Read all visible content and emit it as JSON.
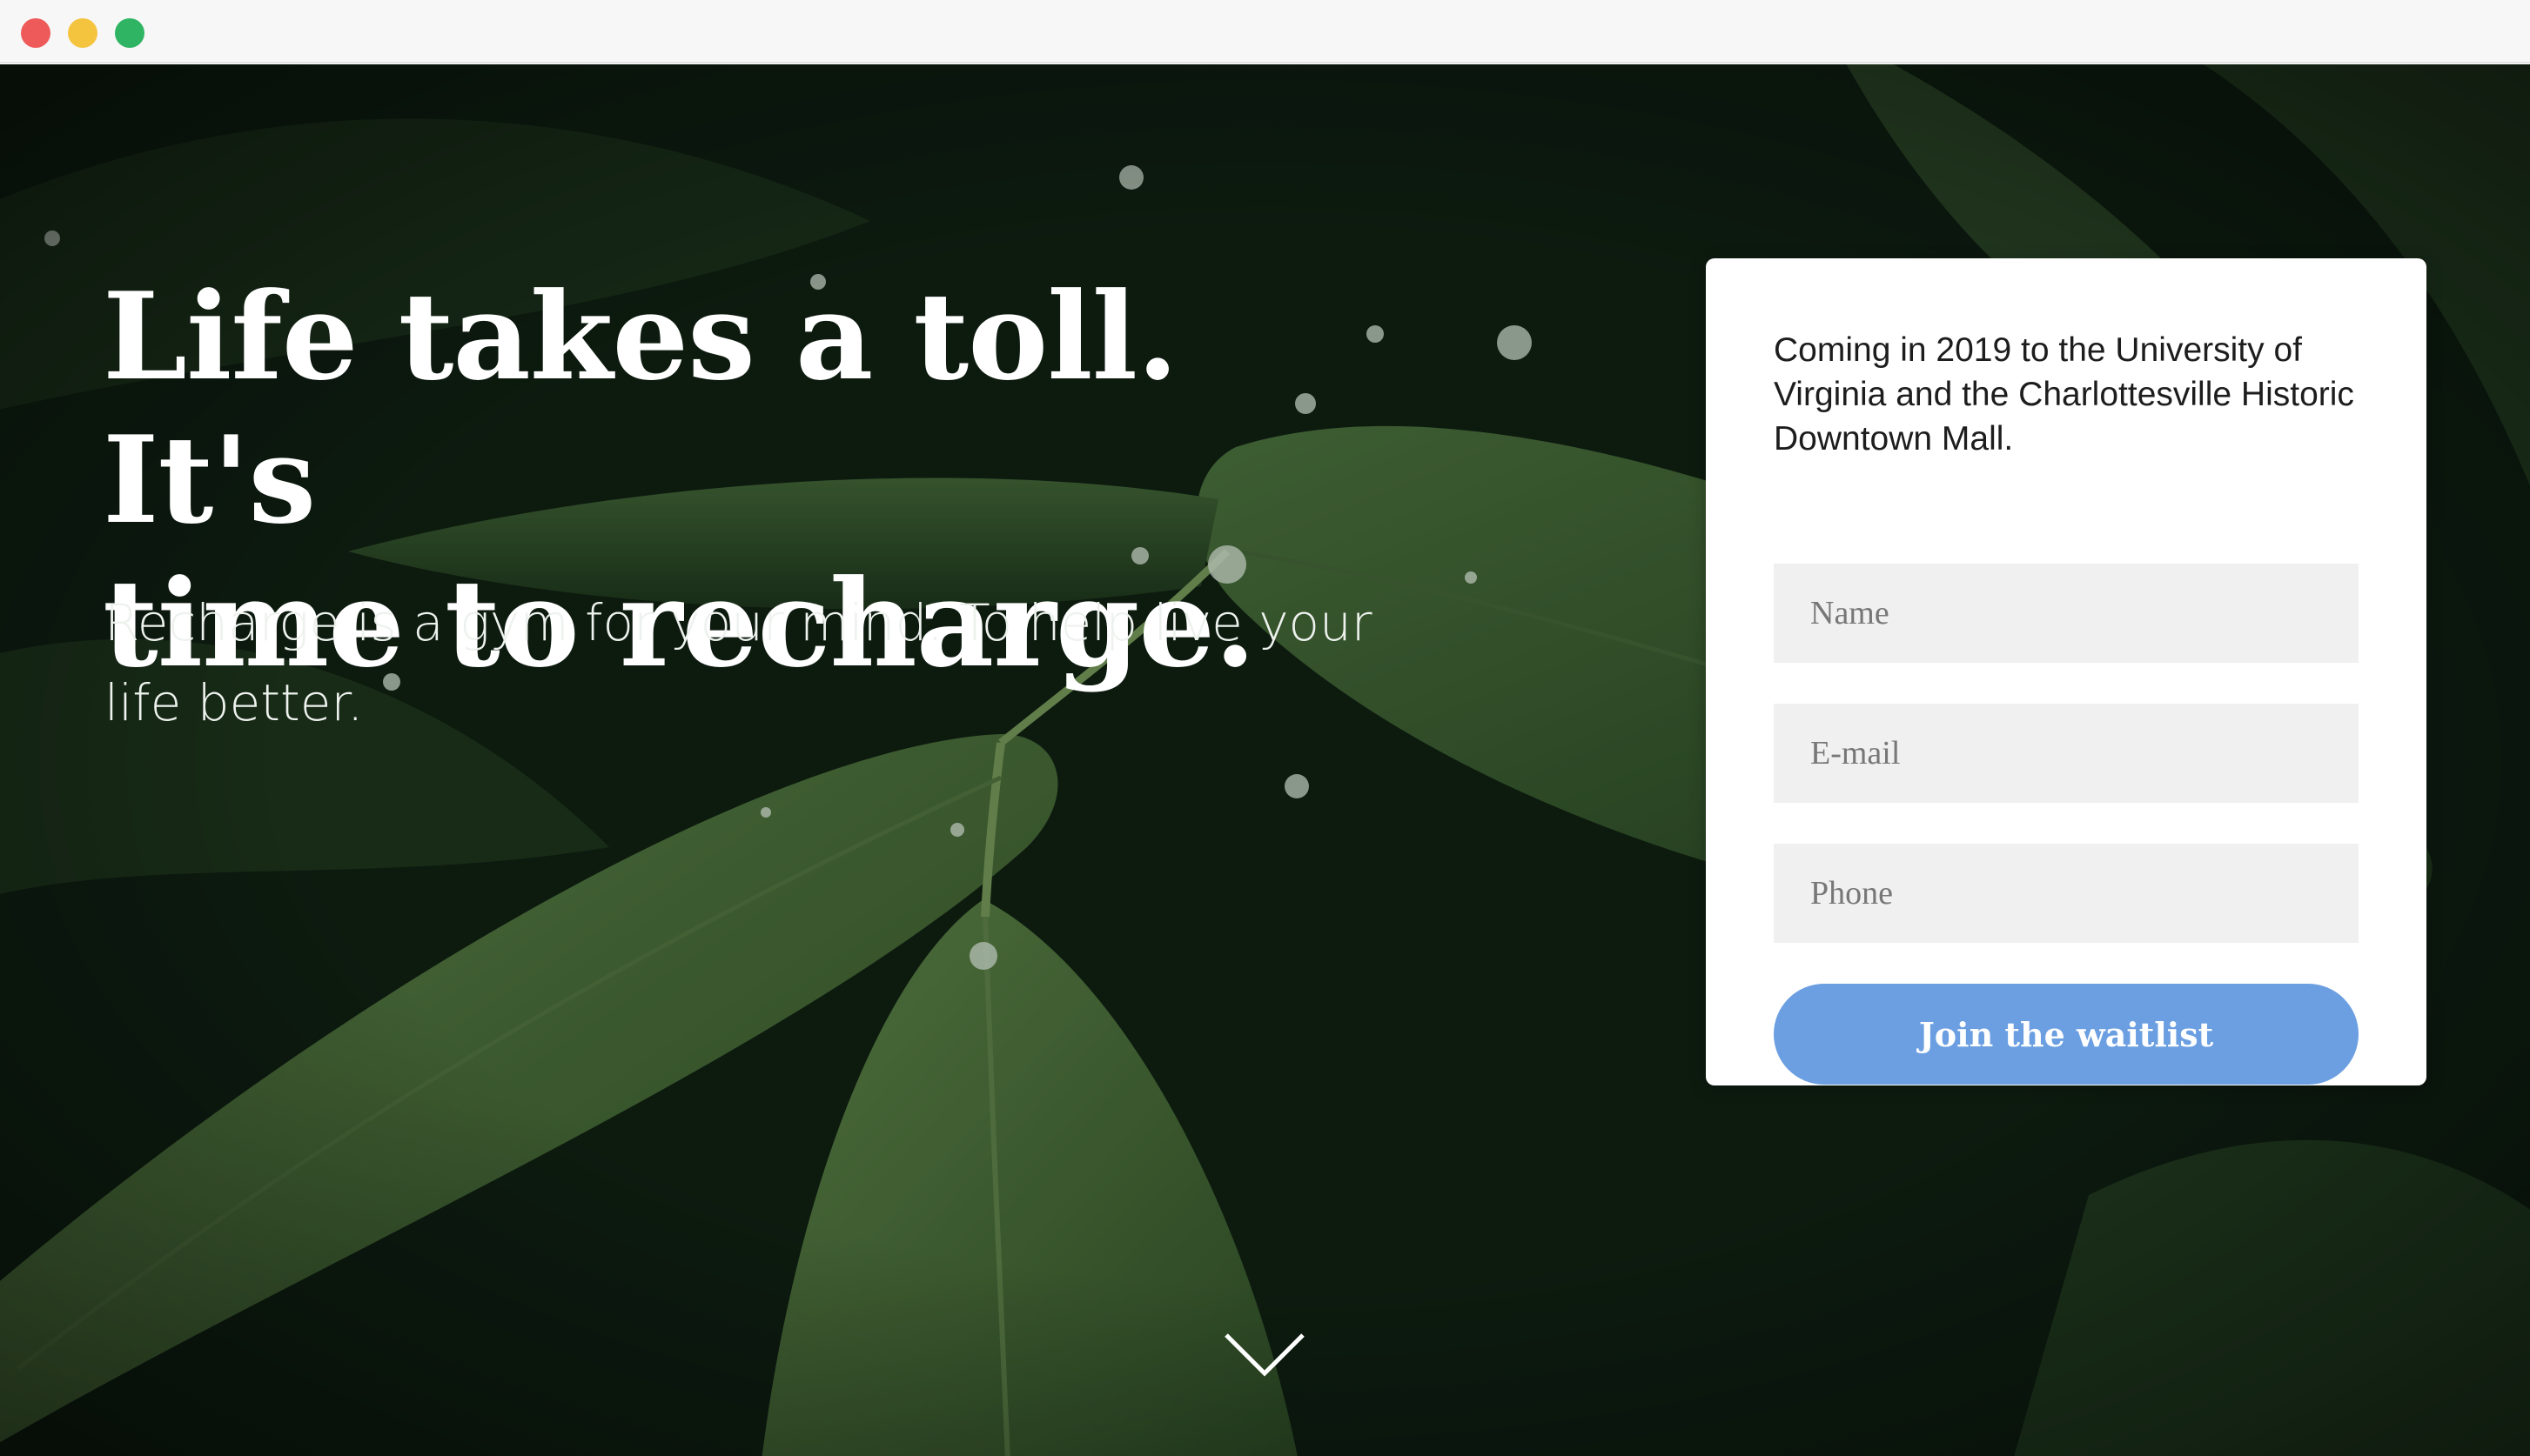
{
  "window": {
    "controls": [
      "close",
      "minimize",
      "maximize"
    ]
  },
  "hero": {
    "headline_line1": "Life takes a toll. It's",
    "headline_line2": "time to recharge.",
    "subtitle": "Recharge is a gym for your mind. To help live your life better.",
    "background": "dark green leaves with water droplets",
    "scroll_icon": "chevron-down-icon"
  },
  "signup": {
    "intro": "Coming in 2019 to the University of Virginia and the Charlottesville Historic Downtown Mall.",
    "name_placeholder": "Name",
    "email_placeholder": "E-mail",
    "phone_placeholder": "Phone",
    "submit_label": "Join the waitlist"
  },
  "colors": {
    "button": "#6b9fe1",
    "field_bg": "#f0f0f0",
    "close": "#ee5a5a",
    "minimize": "#f4c43f",
    "maximize": "#2fb463"
  }
}
